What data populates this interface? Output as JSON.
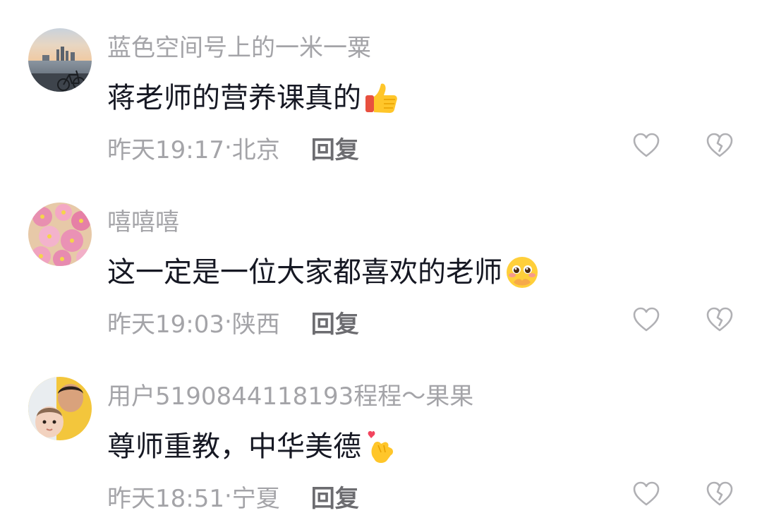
{
  "comments": [
    {
      "username": "蓝色空间号上的一米一粟",
      "content": "蒋老师的营养课真的",
      "emoji": "thumbs-up-emoji",
      "time": "昨天19:17",
      "location": "北京",
      "reply_label": "回复",
      "like_icon": "heart-outline-icon",
      "dislike_icon": "broken-heart-outline-icon"
    },
    {
      "username": "嘻嘻嘻",
      "content": "这一定是一位大家都喜欢的老师",
      "emoji": "shy-pleading-emoji",
      "time": "昨天19:03",
      "location": "陕西",
      "reply_label": "回复",
      "like_icon": "heart-outline-icon",
      "dislike_icon": "broken-heart-outline-icon"
    },
    {
      "username": "用户5190844118193程程～果果",
      "content": "尊师重教，中华美德",
      "emoji": "finger-heart-emoji",
      "time": "昨天18:51",
      "location": "宁夏",
      "reply_label": "回复",
      "like_icon": "heart-outline-icon",
      "dislike_icon": "broken-heart-outline-icon"
    }
  ],
  "separator": "·",
  "colors": {
    "username": "#a4a4a8",
    "content": "#161823",
    "meta": "#a4a4a8",
    "reply": "#6c6c70",
    "icon": "#a4a4a8"
  }
}
